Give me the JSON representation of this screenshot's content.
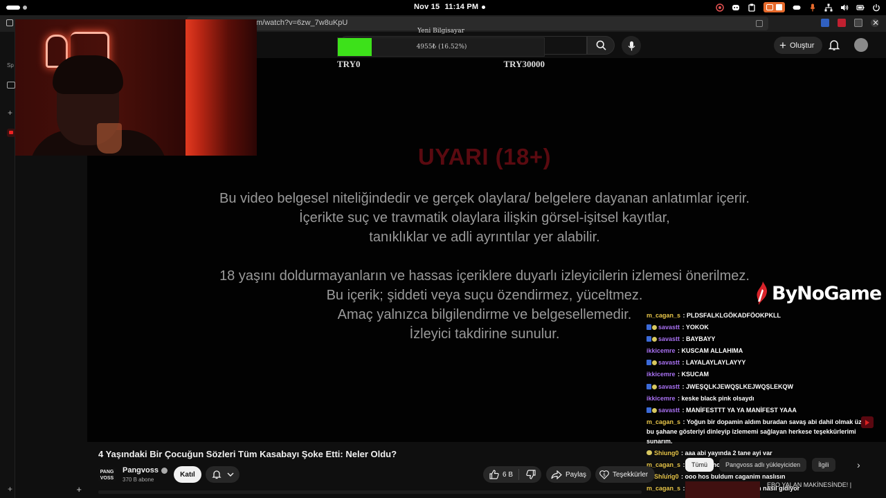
{
  "os": {
    "date": "Nov 15",
    "time": "11:14 PM"
  },
  "browser": {
    "url": "m/watch?v=6zw_7w8uKpU",
    "sidebar_label": "Sp"
  },
  "header": {
    "create_label": "Oluştur"
  },
  "goal": {
    "title": "Yeni Bilgisayar",
    "amount_text": "4955₺ (16.52%)",
    "progress": 0.1652,
    "min_label": "TRY0",
    "max_label": "TRY30000",
    "fill_color": "#3de11a"
  },
  "video": {
    "warning_title": "UYARI (18+)",
    "warning_lines_1": [
      "Bu video belgesel niteliğindedir ve gerçek olaylara/ belgelere dayanan anlatımlar içerir.",
      "İçerikte suç ve travmatik olaylara ilişkin görsel-işitsel kayıtlar,",
      "tanıklıklar ve adli ayrıntılar yer alabilir."
    ],
    "warning_lines_2": [
      "18 yaşını doldurmayanların ve hassas içeriklere duyarlı izleyicilerin izlemesi önerilmez.",
      "Bu içerik; şiddeti veya suçu özendirmez, yüceltmez.",
      "Amaç yalnızca bilgilendirme ve belgesellemedir.",
      "İzleyici takdirine sunulur."
    ],
    "title": "4 Yaşındaki Bir Çocuğun Sözleri Tüm Kasabayı Şoke Etti: Neler Oldu?"
  },
  "channel": {
    "avatar_text": "PANG VOSS",
    "name": "Pangvoss",
    "subscribers": "370 B abone",
    "join_label": "Katıl"
  },
  "actions": {
    "likes": "6 B",
    "share_label": "Paylaş",
    "thanks_label": "Teşekkürler"
  },
  "overlay": {
    "sponsor_logo": "ByNoGame"
  },
  "chat": {
    "messages": [
      {
        "user": "m_cagan_s",
        "color": "#e8c64a",
        "badges": 0,
        "text": "PLDSFALKLGÖKADFÖOKPKLL"
      },
      {
        "user": "savastt",
        "color": "#a770f0",
        "badges": 2,
        "text": "YOKOK"
      },
      {
        "user": "savastt",
        "color": "#a770f0",
        "badges": 2,
        "text": "BAYBAYY"
      },
      {
        "user": "ikkicemre",
        "color": "#a770f0",
        "badges": 0,
        "text": "KUSCAM ALLAHIMA"
      },
      {
        "user": "savastt",
        "color": "#a770f0",
        "badges": 2,
        "text": "LAYALAYLAYLAYYY"
      },
      {
        "user": "ikkicemre",
        "color": "#a770f0",
        "badges": 0,
        "text": "KSUCAM"
      },
      {
        "user": "savastt",
        "color": "#a770f0",
        "badges": 2,
        "text": "JWEŞQLKJEWQŞLKEJWQŞLEKQW"
      },
      {
        "user": "ikkicemre",
        "color": "#a770f0",
        "badges": 0,
        "text": "keske black pink olsaydı"
      },
      {
        "user": "savastt",
        "color": "#a770f0",
        "badges": 2,
        "text": "MANİFESTTT YA YA MANİFEST YAAA"
      },
      {
        "user": "m_cagan_s",
        "color": "#e8c64a",
        "badges": 0,
        "text": "Yoğun bir dopamin aldım buradan savaş abi dahil olmak üzere bu şahane gösteriyi dinleyip izlememi sağlayan herkese teşekkürlerimi sunarım."
      },
      {
        "user": "Shiung0",
        "color": "#e8c64a",
        "badges": 1,
        "text": "aaa abi yayında 2 tane ayi var"
      },
      {
        "user": "m_cagan_s",
        "color": "#e8c64a",
        "badges": 0,
        "text": "oo Enes hoş geldin"
      },
      {
        "user": "Shiung0",
        "color": "#e8c64a",
        "badges": 1,
        "text": "ooo hos buldum caganim naslısın"
      },
      {
        "user": "m_cagan_s",
        "color": "#e8c64a",
        "badges": 0,
        "text": "İyiyim iyiyim sen nasılsın nasıl gidiyor"
      }
    ]
  },
  "recommendations": {
    "chips": [
      "Tümü",
      "Pangvoss adlı yükleyiciden",
      "İlgili"
    ],
    "partial_title": "EBO YALAN MAKİNESİNDE! |"
  }
}
